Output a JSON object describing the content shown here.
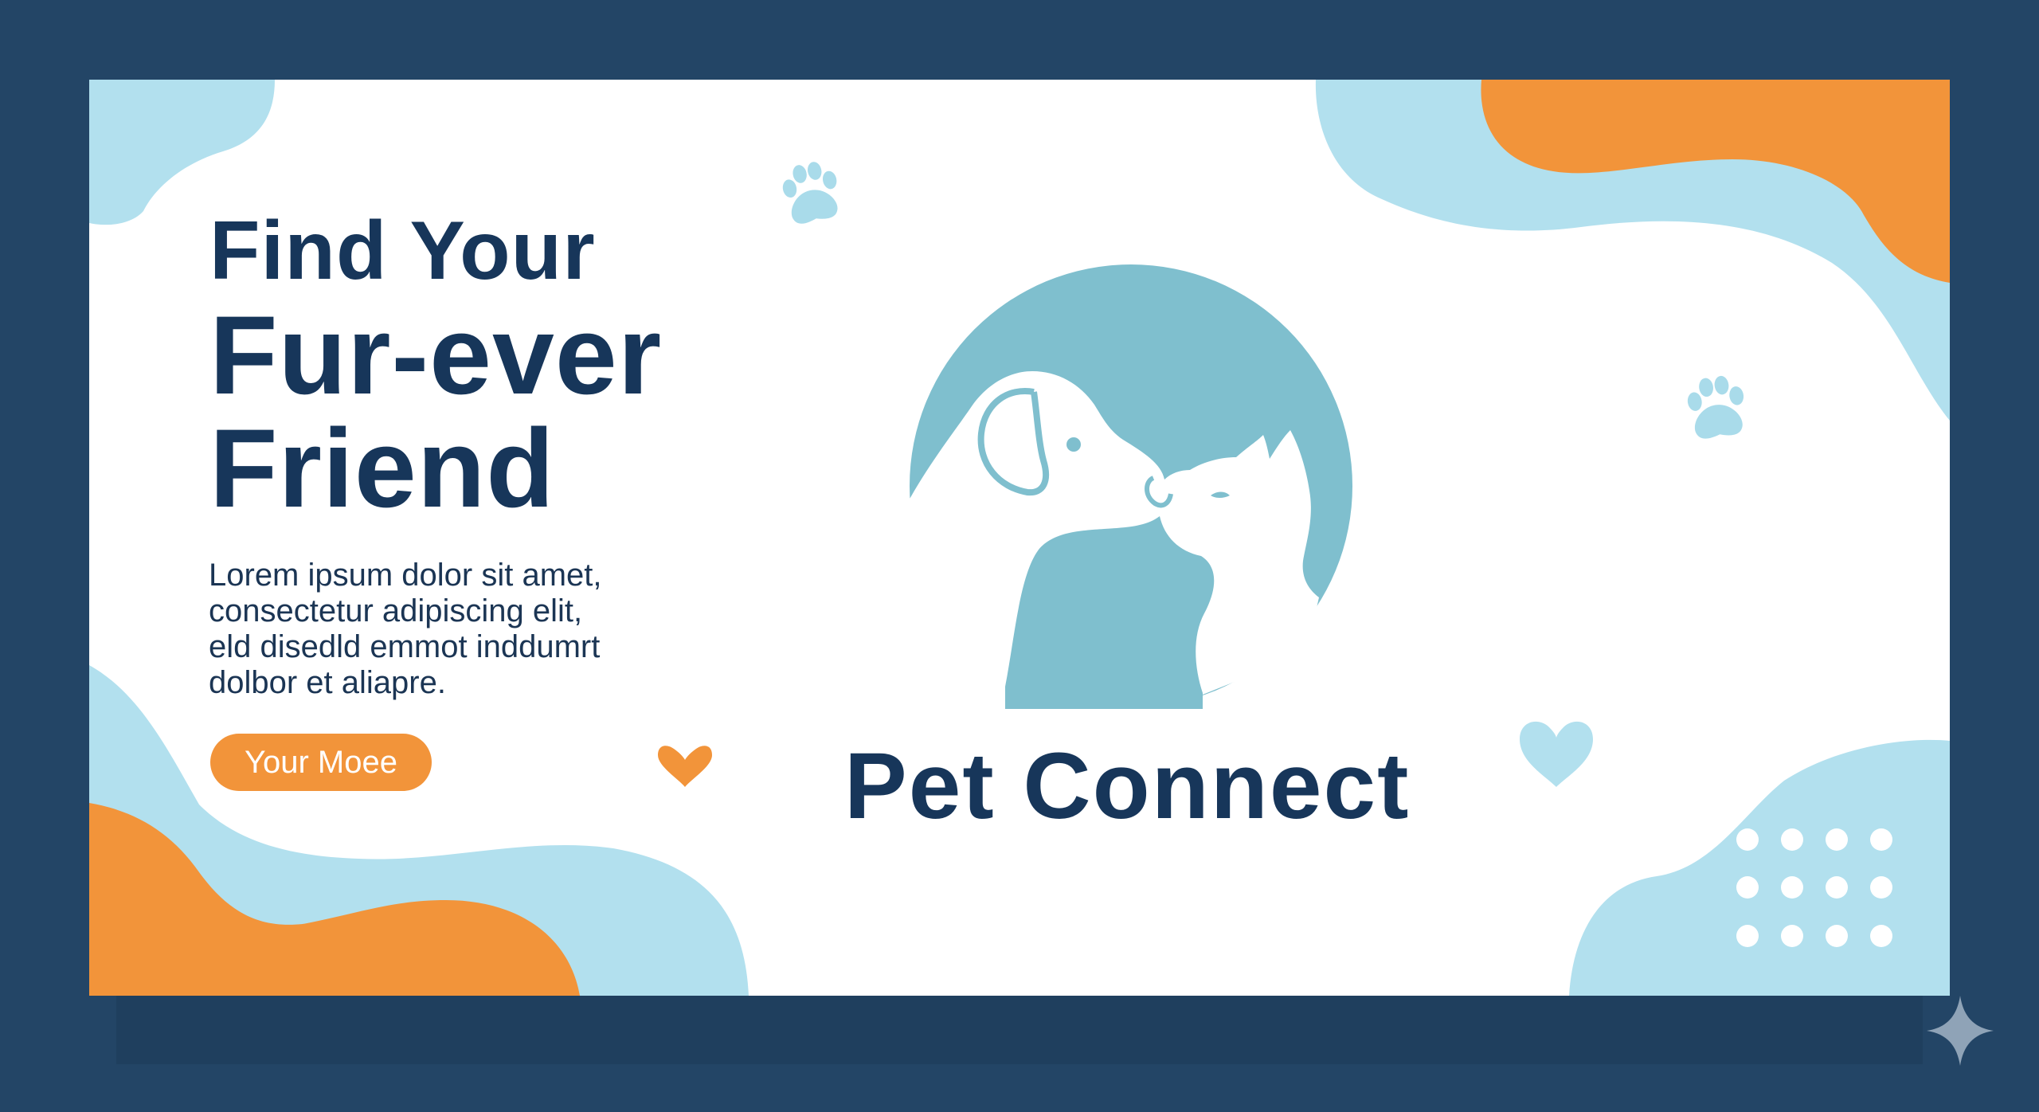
{
  "hero": {
    "headline": [
      "Find Your",
      "Fur-ever",
      "Friend"
    ],
    "body": [
      "Lorem ipsum dolor sit amet,",
      "consectetur adipiscing elit,",
      "eld disedld emmot inddumrt",
      "dolbor et aliapre."
    ],
    "cta_label": "Your Moee"
  },
  "brand": {
    "name": "Pet Connect",
    "logo_icon": "dog-and-cat-silhouette-icon"
  },
  "decorations": {
    "icons": [
      "paw-print-icon",
      "paw-print-icon",
      "heart-icon",
      "heart-icon",
      "sparkle-icon"
    ],
    "dot_grid": {
      "rows": 3,
      "columns": 4
    }
  },
  "colors": {
    "frame": "#234566",
    "card": "#ffffff",
    "navy_text": "#17365a",
    "orange": "#f2943a",
    "light_blue": "#b2e0ee",
    "logo_blue": "#7fbfce"
  }
}
